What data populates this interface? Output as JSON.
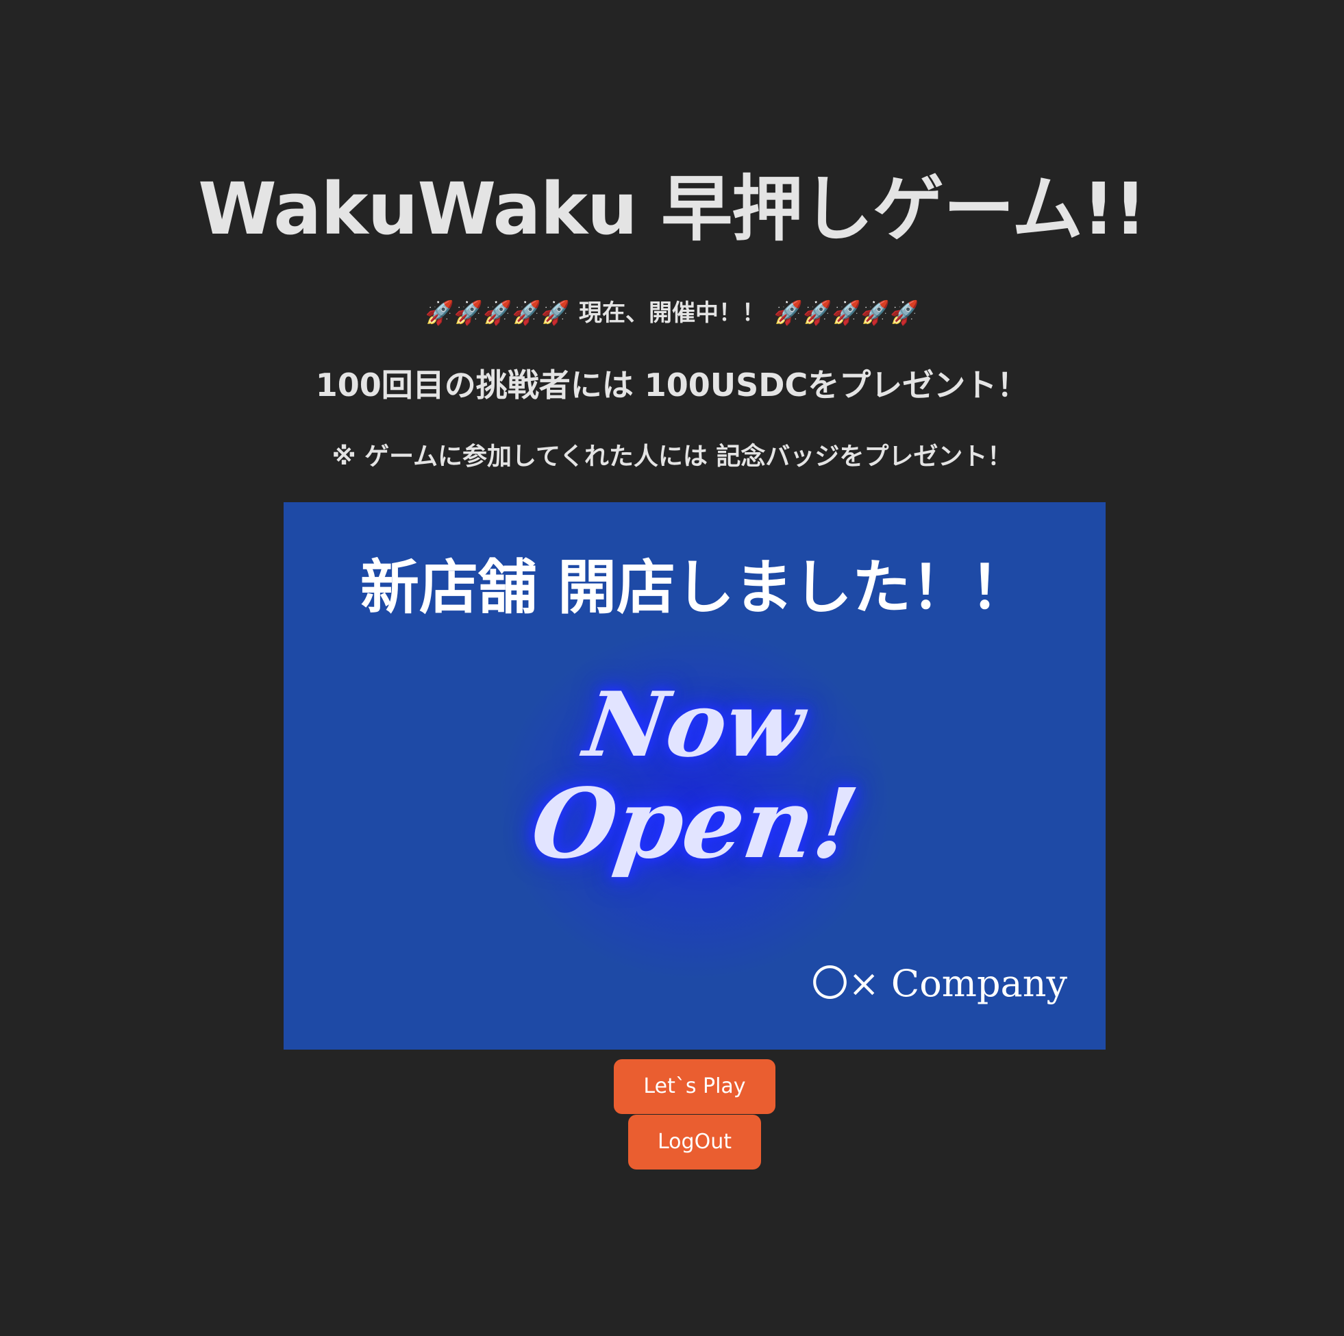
{
  "page": {
    "title": "WakuWaku 早押しゲーム!!"
  },
  "status": {
    "rockets_left": "🚀🚀🚀🚀🚀",
    "text": " 現在、開催中！！ ",
    "rockets_right": "🚀🚀🚀🚀🚀"
  },
  "prize": {
    "text": "100回目の挑戦者には 100USDCをプレゼント！"
  },
  "badge": {
    "text": "※ ゲームに参加してくれた人には 記念バッジをプレゼント！"
  },
  "banner": {
    "heading": "新店舗 開店しました！！",
    "now_line": "Now",
    "open_line": "Open!",
    "company": "〇× Company",
    "background_color": "#1e4aa6"
  },
  "buttons": {
    "play_label": "Let`s Play",
    "logout_label": "LogOut",
    "accent_color": "#ea5e30"
  }
}
